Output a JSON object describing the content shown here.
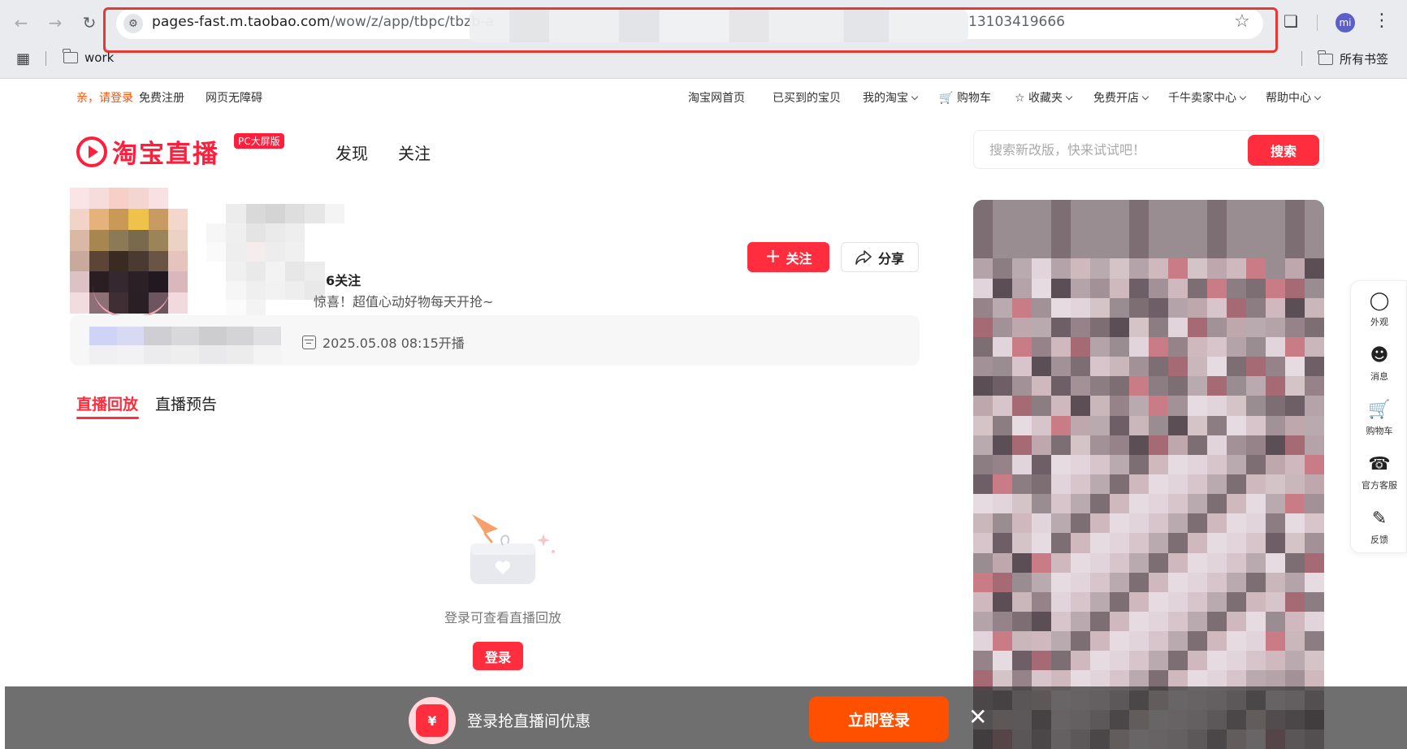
{
  "browser": {
    "url_host": "pages-fast.m.taobao.com",
    "url_path": "/wow/z/app/tbpc/tbzb-a",
    "url_tail": "13103419666",
    "profile_initials": "mi",
    "bookmarks": {
      "work": "work",
      "all": "所有书签"
    }
  },
  "topbar": {
    "greeting": "亲，请登录",
    "register": "免费注册",
    "accessibility": "网页无障碍",
    "home": "淘宝网首页",
    "bought": "已买到的宝贝",
    "my_taobao": "我的淘宝",
    "cart": "购物车",
    "favorites": "收藏夹",
    "open_shop": "免费开店",
    "seller_center": "千牛卖家中心",
    "help": "帮助中心"
  },
  "header": {
    "logo_text": "淘宝直播",
    "logo_badge": "PC大屏版",
    "nav": [
      "发现",
      "关注"
    ],
    "search_placeholder": "搜索新改版，快来试试吧！",
    "search_button": "搜索"
  },
  "profile": {
    "follow_count": "6关注",
    "slogan": "惊喜！超值心动好物每天开抢~",
    "follow_button": "关注",
    "share_button": "分享"
  },
  "live": {
    "time": "2025.05.08 08:15开播"
  },
  "tabs": [
    "直播回放",
    "直播预告"
  ],
  "empty": {
    "text": "登录可查看直播回放",
    "login": "登录"
  },
  "side_tools": [
    "外观",
    "消息",
    "购物车",
    "官方客服",
    "反馈"
  ],
  "bottom": {
    "text": "登录抢直播间优惠",
    "cta": "立即登录",
    "coupon_symbol": "¥"
  },
  "colors": {
    "brand_red": "#ff2d3d",
    "taobao_orange": "#ff5000",
    "annotation_red": "#e53935"
  }
}
